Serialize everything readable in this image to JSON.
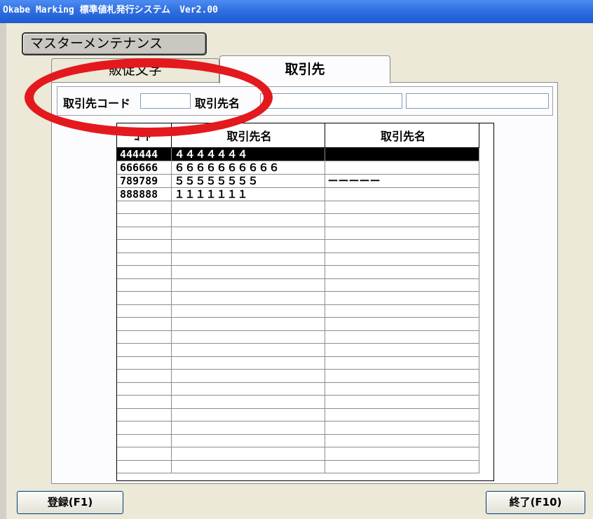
{
  "window": {
    "title": "Okabe Marking 標準値札発行システム　Ver2.00"
  },
  "master_button": {
    "label": "マスターメンテナンス"
  },
  "tabs": [
    {
      "label": "販促文字",
      "active": false
    },
    {
      "label": "取引先",
      "active": true
    }
  ],
  "search": {
    "code_label": "取引先コード",
    "name_label": "取引先名",
    "code_value": "",
    "name_value": "",
    "name2_value": ""
  },
  "grid": {
    "columns": [
      "ｺｰﾄﾞ",
      "取引先名",
      "取引先名"
    ],
    "rows": [
      {
        "code": "444444",
        "name": "４４４４４４４",
        "name2": "",
        "selected": true
      },
      {
        "code": "666666",
        "name": "６６６６６６６６６６",
        "name2": ""
      },
      {
        "code": "789789",
        "name": "５５５５５５５５",
        "name2": "ーーーーー"
      },
      {
        "code": "888888",
        "name": "１１１１１１１",
        "name2": ""
      }
    ]
  },
  "footer": {
    "register_label": "登録(F1)",
    "exit_label": "終了(F10)"
  },
  "annotation": {
    "color": "#e3191e"
  }
}
